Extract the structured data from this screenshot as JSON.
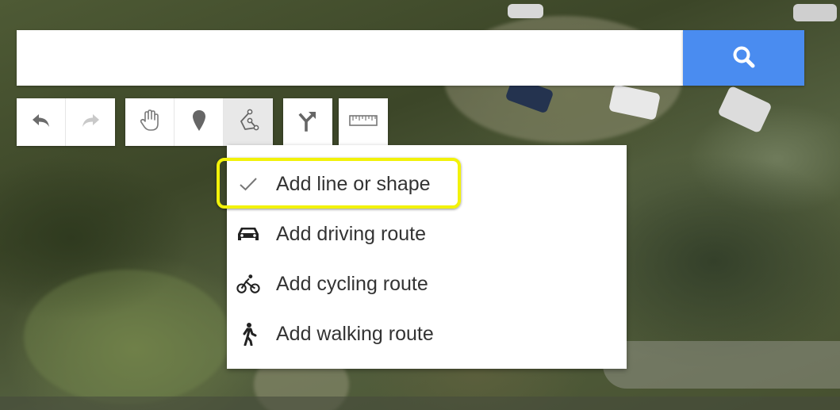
{
  "search": {
    "value": "",
    "placeholder": ""
  },
  "search_button": {
    "icon": "search-icon",
    "color": "#4a8cf0"
  },
  "toolbar": {
    "groups": [
      {
        "items": [
          {
            "icon": "undo-icon"
          },
          {
            "icon": "redo-icon"
          }
        ]
      },
      {
        "items": [
          {
            "icon": "hand-icon"
          },
          {
            "icon": "marker-icon"
          },
          {
            "icon": "draw-line-icon",
            "active": true
          }
        ]
      },
      {
        "items": [
          {
            "icon": "directions-icon"
          }
        ]
      },
      {
        "items": [
          {
            "icon": "ruler-icon"
          }
        ]
      }
    ]
  },
  "draw_menu": {
    "items": [
      {
        "label": "Add line or shape",
        "icon": "checkmark-icon",
        "selected": true
      },
      {
        "label": "Add driving route",
        "icon": "car-icon"
      },
      {
        "label": "Add cycling route",
        "icon": "bicycle-icon"
      },
      {
        "label": "Add walking route",
        "icon": "walking-icon"
      }
    ]
  },
  "highlight": {
    "color": "#f2f20a"
  }
}
